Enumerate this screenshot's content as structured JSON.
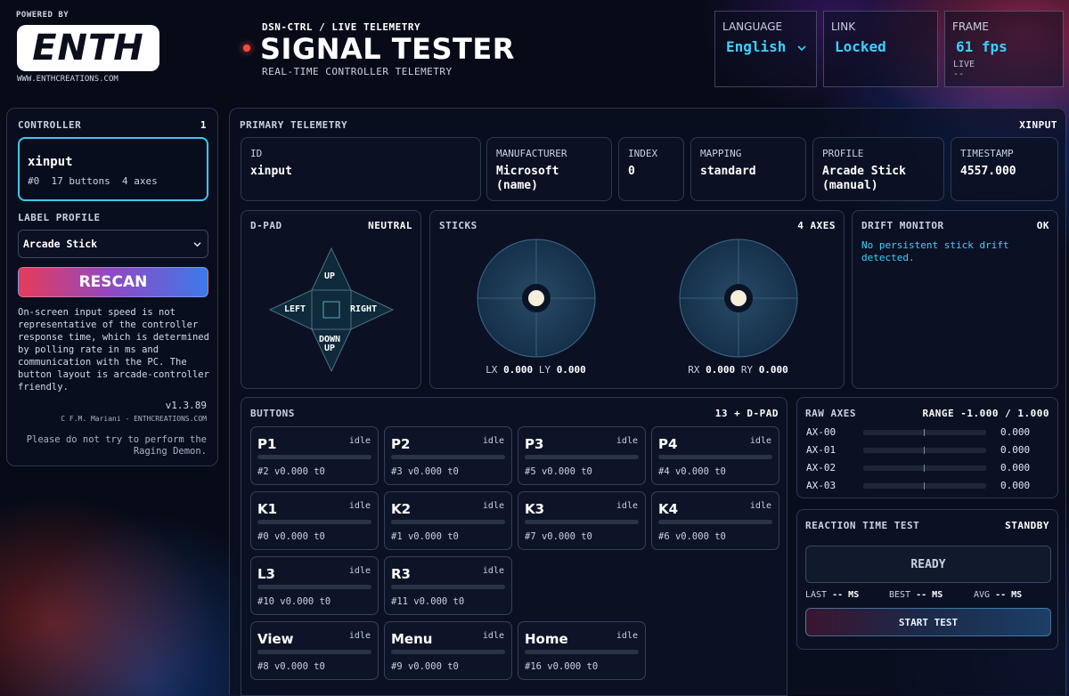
{
  "brand": {
    "powered_by": "POWERED BY",
    "logo_text": "ENTH",
    "site": "WWW.ENTHCREATIONS.COM"
  },
  "header": {
    "breadcrumb": "DSN-CTRL / LIVE TELEMETRY",
    "title": "SIGNAL TESTER",
    "subtitle": "REAL-TIME CONTROLLER TELEMETRY",
    "language": {
      "label": "LANGUAGE",
      "value": "English"
    },
    "link": {
      "label": "LINK",
      "value": "Locked"
    },
    "frame": {
      "label": "FRAME",
      "value": "61 fps",
      "status": "LIVE",
      "extra": "--"
    }
  },
  "sidebar": {
    "controller_label": "CONTROLLER",
    "controller_count": "1",
    "controller": {
      "name": "xinput",
      "details": "#0  17 buttons  4 axes"
    },
    "label_profile_label": "LABEL PROFILE",
    "label_profile_value": "Arcade Stick",
    "rescan_label": "RESCAN",
    "note": "On-screen input speed is not representative of the controller response time, which is determined by polling rate in ms and communication with the PC. The button layout is arcade-controller friendly.",
    "version": "v1.3.89",
    "copyright": "C F.M. Mariani - ENTHCREATIONS.COM",
    "easter": "Please do not try to perform the Raging Demon."
  },
  "telemetry": {
    "title": "PRIMARY TELEMETRY",
    "api": "XINPUT",
    "info": [
      {
        "label": "ID",
        "value": "xinput"
      },
      {
        "label": "MANUFACTURER",
        "value": "Microsoft (name)"
      },
      {
        "label": "INDEX",
        "value": "0"
      },
      {
        "label": "MAPPING",
        "value": "standard"
      },
      {
        "label": "PROFILE",
        "value": "Arcade Stick (manual)"
      },
      {
        "label": "TIMESTAMP",
        "value": "4557.000"
      }
    ]
  },
  "dpad": {
    "title": "D-PAD",
    "state": "NEUTRAL",
    "up": "UP",
    "down": "DOWN",
    "left": "LEFT",
    "right": "RIGHT"
  },
  "sticks": {
    "title": "STICKS",
    "count": "4 AXES",
    "left": {
      "x_label": "LX",
      "x": "0.000",
      "y_label": "LY",
      "y": "0.000"
    },
    "right": {
      "x_label": "RX",
      "x": "0.000",
      "y_label": "RY",
      "y": "0.000"
    }
  },
  "drift": {
    "title": "DRIFT MONITOR",
    "status": "OK",
    "message": "No persistent stick drift detected."
  },
  "buttons": {
    "title": "BUTTONS",
    "count": "13 + D-PAD",
    "items": [
      {
        "name": "P1",
        "state": "idle",
        "meta": "#2 v0.000 t0",
        "level": 0
      },
      {
        "name": "P2",
        "state": "idle",
        "meta": "#3 v0.000 t0",
        "level": 0
      },
      {
        "name": "P3",
        "state": "idle",
        "meta": "#5 v0.000 t0",
        "level": 0
      },
      {
        "name": "P4",
        "state": "idle",
        "meta": "#4 v0.000 t0",
        "level": 0
      },
      {
        "name": "K1",
        "state": "idle",
        "meta": "#0 v0.000 t0",
        "level": 0
      },
      {
        "name": "K2",
        "state": "idle",
        "meta": "#1 v0.000 t0",
        "level": 0
      },
      {
        "name": "K3",
        "state": "idle",
        "meta": "#7 v0.000 t0",
        "level": 0
      },
      {
        "name": "K4",
        "state": "idle",
        "meta": "#6 v0.000 t0",
        "level": 0
      },
      {
        "name": "L3",
        "state": "idle",
        "meta": "#10 v0.000 t0",
        "level": 0
      },
      {
        "name": "R3",
        "state": "idle",
        "meta": "#11 v0.000 t0",
        "level": 0
      },
      {
        "name": "View",
        "state": "idle",
        "meta": "#8 v0.000 t0",
        "level": 0
      },
      {
        "name": "Menu",
        "state": "idle",
        "meta": "#9 v0.000 t0",
        "level": 0
      },
      {
        "name": "Home",
        "state": "idle",
        "meta": "#16 v0.000 t0",
        "level": 0
      }
    ]
  },
  "raw_axes": {
    "title": "RAW AXES",
    "range": "RANGE -1.000 / 1.000",
    "axes": [
      {
        "label": "AX-00",
        "value": "0.000"
      },
      {
        "label": "AX-01",
        "value": "0.000"
      },
      {
        "label": "AX-02",
        "value": "0.000"
      },
      {
        "label": "AX-03",
        "value": "0.000"
      }
    ]
  },
  "reaction": {
    "title": "REACTION TIME TEST",
    "status": "STANDBY",
    "ready": "READY",
    "last_label": "LAST",
    "last": "-- MS",
    "best_label": "BEST",
    "best": "-- MS",
    "avg_label": "AVG",
    "avg": "-- MS",
    "start_label": "START TEST"
  },
  "colors": {
    "accent": "#37d3ff",
    "live_dot": "#ff4a3a",
    "rescan_from": "#e43c58",
    "rescan_to": "#3d7ae8"
  },
  "icons": {
    "language_dropdown": "chevron-down-icon",
    "profile_dropdown": "chevron-down-icon",
    "live": "status-dot-icon"
  }
}
